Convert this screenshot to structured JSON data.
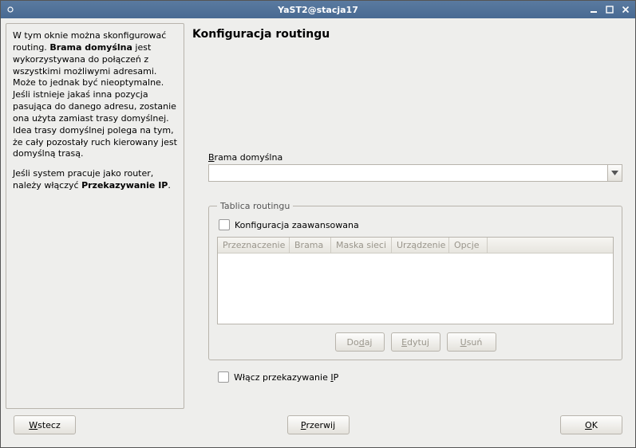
{
  "window": {
    "title": "YaST2@stacja17"
  },
  "help": {
    "p1_a": "W tym oknie można skonfigurować routing. ",
    "p1_b": "Brama domyślna",
    "p1_c": " jest wykorzystywana do połączeń z wszystkimi możliwymi adresami. Może to jednak być nieoptymalne. Jeśli istnieje jakaś inna pozycja pasująca do danego adresu, zostanie ona użyta zamiast trasy domyślnej. Idea trasy domyślnej polega na tym, że cały pozostały ruch kierowany jest domyślną trasą.",
    "p2_a": "Jeśli system pracuje jako router, należy włączyć ",
    "p2_b": "Przekazywanie IP",
    "p2_c": "."
  },
  "main": {
    "title": "Konfiguracja routingu",
    "gateway_label_pre": "B",
    "gateway_label_post": "rama domyślna",
    "gateway_value": "",
    "routing_legend": "Tablica routingu",
    "advanced_cfg_label": "Konfiguracja zaawansowana",
    "columns": {
      "c0": "Przeznaczenie",
      "c1": "Brama",
      "c2": "Maska sieci",
      "c3": "Urządzenie",
      "c4": "Opcje"
    },
    "btn_add_pre": "Do",
    "btn_add_u": "d",
    "btn_add_post": "aj",
    "btn_edit_u": "E",
    "btn_edit_post": "dytuj",
    "btn_del_u": "U",
    "btn_del_post": "suń",
    "ip_fwd_pre": "Włącz przekazywanie ",
    "ip_fwd_u": "I",
    "ip_fwd_post": "P"
  },
  "footer": {
    "back_u": "W",
    "back_post": "stecz",
    "abort_u": "P",
    "abort_post": "rzerwij",
    "ok_u": "O",
    "ok_post": "K"
  }
}
